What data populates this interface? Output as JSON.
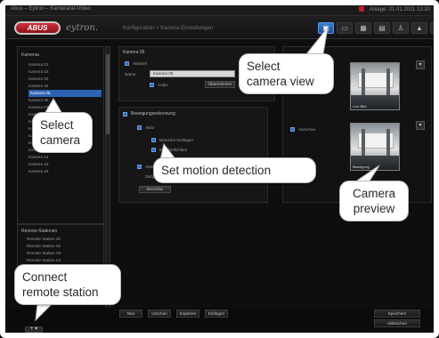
{
  "window": {
    "title": "Abus – Eytron – Kamerarat-Video",
    "status": "Anlage: 01.01.2011 13:30"
  },
  "header": {
    "logo": "ABUS",
    "brand": "eytron.",
    "breadcrumb": "Konfiguration > Kamera-Einstellungen",
    "nav_icons": [
      "camera-view-icon",
      "record-icon",
      "grid-icon",
      "monitor-icon",
      "user-icon",
      "lock-icon",
      "help-icon"
    ],
    "nav_glyphs": [
      "▣",
      "▭",
      "▦",
      "▤",
      "♙",
      "▲",
      "?"
    ]
  },
  "sidebar": {
    "root": "Kameras",
    "items": [
      "Kamera 01",
      "Kamera 02",
      "Kamera 03",
      "Kamera 04",
      "Kamera 05",
      "Kamera 06",
      "Kamera 07",
      "Kamera 08",
      "Kamera 09",
      "Kamera 10",
      "Kamera 11",
      "Kamera 12",
      "Kamera 13",
      "Kamera 14",
      "Kamera 15",
      "Kamera 16"
    ],
    "selected_index": 4,
    "remote_root": "Remote-Stationen",
    "remote_items": [
      "Remote Station 01",
      "Remote Station 02",
      "Remote Station 03",
      "Remote Station 04",
      "Remote Station 05",
      "Remote Station 06"
    ],
    "connect_button": "+ ▾"
  },
  "main": {
    "camera_panel": {
      "title": "Kamera 05",
      "enabled_label": "Aktiviert",
      "name_label": "Name",
      "name_value": "Kamera 05",
      "audio_label": "Audio",
      "button": "Übernehmen"
    },
    "motion_panel": {
      "title": "Bewegungserkennung",
      "active_label": "Aktiv",
      "option1": "Bereiche festlegen",
      "option2": "Empfindlichkeit",
      "option3": "Alarmaufzeichnung",
      "option4": "Zeitplan",
      "button": "Bereiche"
    },
    "preview": {
      "label": "Vorschau",
      "caption1": "Live-Bild",
      "caption2": "Bewegung",
      "more": "▾"
    },
    "bottom_buttons": [
      "Neu",
      "Löschen",
      "Kopieren",
      "Einfügen"
    ],
    "save_button": "Speichern",
    "cancel_button": "Abbrechen"
  },
  "callouts": {
    "select_camera_view": "Select\ncamera view",
    "select_camera": "Select\ncamera",
    "set_motion_detection": "Set motion detection",
    "camera_preview": "Camera\npreview",
    "connect_remote_station": "Connect\nremote station"
  }
}
